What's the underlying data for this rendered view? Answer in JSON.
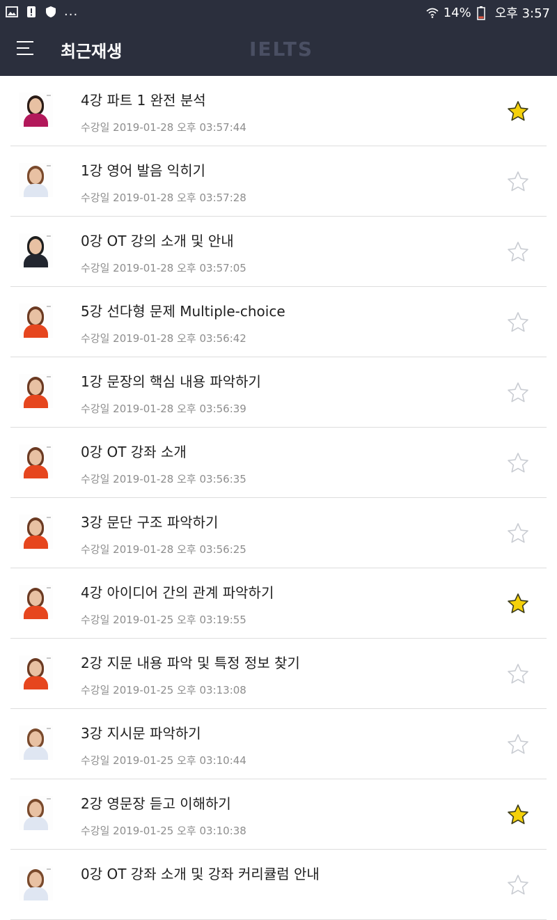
{
  "status_bar": {
    "left_icons": [
      "image-icon",
      "alert-icon",
      "shield-icon"
    ],
    "more": "...",
    "battery_percent": "14%",
    "time": "오후 3:57"
  },
  "header": {
    "title": "최근재생",
    "logo": "IELTS",
    "bg_color": "#2b2f3d"
  },
  "items": [
    {
      "title": "4강 파트 1 완전 분석",
      "date": "수강일 2019-01-28 오후 03:57:44",
      "favorite": true,
      "thumb": "woman-magenta"
    },
    {
      "title": "1강 영어 발음 익히기",
      "date": "수강일 2019-01-28 오후 03:57:28",
      "favorite": false,
      "thumb": "woman-light"
    },
    {
      "title": "0강 OT 강의 소개 및 안내",
      "date": "수강일 2019-01-28 오후 03:57:05",
      "favorite": false,
      "thumb": "man-suit"
    },
    {
      "title": "5강 선다형 문제 Multiple-choice",
      "date": "수강일 2019-01-28 오후 03:56:42",
      "favorite": false,
      "thumb": "woman-red"
    },
    {
      "title": "1강 문장의 핵심 내용 파악하기",
      "date": "수강일 2019-01-28 오후 03:56:39",
      "favorite": false,
      "thumb": "woman-red"
    },
    {
      "title": "0강 OT 강좌 소개",
      "date": "수강일 2019-01-28 오후 03:56:35",
      "favorite": false,
      "thumb": "woman-red"
    },
    {
      "title": "3강 문단 구조 파악하기",
      "date": "수강일 2019-01-28 오후 03:56:25",
      "favorite": false,
      "thumb": "woman-red"
    },
    {
      "title": "4강 아이디어 간의 관계 파악하기",
      "date": "수강일 2019-01-25 오후 03:19:55",
      "favorite": true,
      "thumb": "woman-red"
    },
    {
      "title": "2강 지문 내용 파악 및 특정 정보 찾기",
      "date": "수강일 2019-01-25 오후 03:13:08",
      "favorite": false,
      "thumb": "woman-red"
    },
    {
      "title": "3강 지시문 파악하기",
      "date": "수강일 2019-01-25 오후 03:10:44",
      "favorite": false,
      "thumb": "woman-light"
    },
    {
      "title": "2강 영문장 듣고 이해하기",
      "date": "수강일 2019-01-25 오후 03:10:38",
      "favorite": true,
      "thumb": "woman-light"
    },
    {
      "title": "0강 OT 강좌 소개 및 강좌 커리큘럼 안내",
      "date": "",
      "favorite": false,
      "thumb": "woman-light"
    }
  ],
  "colors": {
    "star_active": "#f5d10a",
    "star_active_stroke": "#3a3a1a",
    "star_inactive_stroke": "#c9ccd2",
    "divider": "#dddddd"
  }
}
